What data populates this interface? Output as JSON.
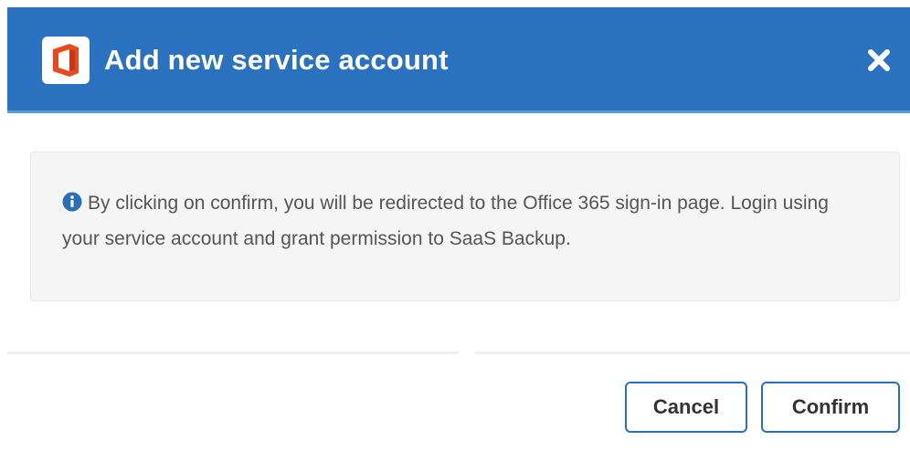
{
  "dialog": {
    "title": "Add new service account",
    "close_icon": "close-icon",
    "logo_icon": "office-logo-icon"
  },
  "info": {
    "icon": "info-icon",
    "message": "By clicking on confirm, you will be redirected to the Office 365 sign-in page. Login using your service account and grant permission to SaaS Backup."
  },
  "footer": {
    "cancel_label": "Cancel",
    "confirm_label": "Confirm"
  },
  "colors": {
    "header": "#2a72c0",
    "logo_orange": "#e8491d",
    "button_border": "#2a6fb8",
    "info_icon": "#2a6fb8"
  }
}
